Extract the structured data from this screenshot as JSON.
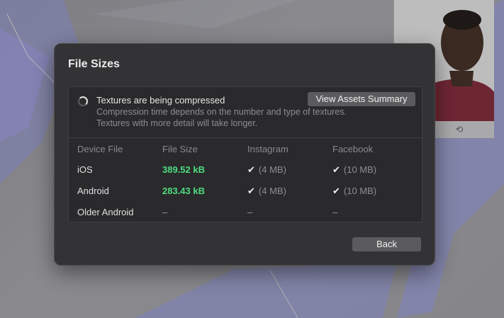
{
  "dialog": {
    "title": "File Sizes",
    "status": {
      "title": "Textures are being compressed",
      "description": "Compression time depends on the number and type of textures. Textures with more detail will take longer.",
      "summary_button": "View Assets Summary"
    },
    "table": {
      "headers": [
        "Device File",
        "File Size",
        "Instagram",
        "Facebook"
      ],
      "rows": [
        {
          "device": "iOS",
          "size": "389.52 kB",
          "instagram": "(4 MB)",
          "facebook": "(10 MB)"
        },
        {
          "device": "Android",
          "size": "283.43 kB",
          "instagram": "(4 MB)",
          "facebook": "(10 MB)"
        },
        {
          "device": "Older Android",
          "size": "–",
          "instagram": "–",
          "facebook": "–"
        }
      ]
    },
    "back_button": "Back"
  },
  "colors": {
    "dialog_bg": "#333335",
    "file_size_green": "#4ddb7e",
    "button_bg": "#5b5b5e"
  },
  "icons": {
    "spinner": "loading-spinner-icon",
    "check": "checkmark-icon",
    "rotate": "rotate-icon"
  }
}
